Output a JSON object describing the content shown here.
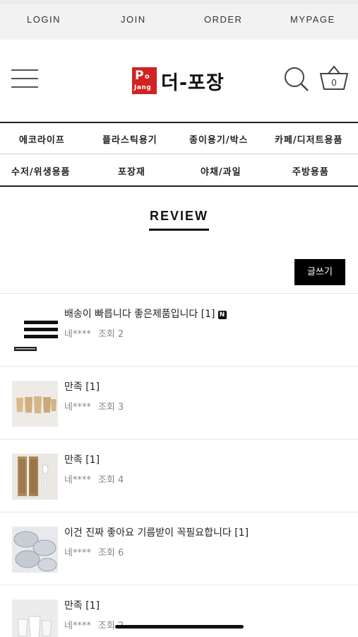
{
  "topnav": {
    "login": "LOGIN",
    "join": "JOIN",
    "order": "ORDER",
    "mypage": "MYPAGE"
  },
  "header": {
    "logo_mark_p": "P",
    "logo_mark_o": "o",
    "logo_mark_jang": "Jang",
    "logo_text": "더-포장",
    "cart_count": "0",
    "icons": {
      "menu": "hamburger-menu-icon",
      "search": "search-icon",
      "cart": "shopping-basket-icon"
    },
    "brand_color": "#d32222"
  },
  "categories": {
    "row1": [
      "에코라이프",
      "플라스틱용기",
      "종이용기/박스",
      "카페/디저트용품"
    ],
    "row2": [
      "수저/위생용품",
      "포장재",
      "야채/과일",
      "주방용품"
    ]
  },
  "review": {
    "title": "REVIEW",
    "write_button": "글쓰기"
  },
  "reviews": [
    {
      "title": "배송이 빠릅니다 좋은제품입니다 [1]",
      "badge": "N",
      "author": "네****",
      "views": "조회 2",
      "thumb": "striped-logo-product"
    },
    {
      "title": "만족 [1]",
      "author": "네****",
      "views": "조회 3",
      "thumb": "paper-cups"
    },
    {
      "title": "만족 [1]",
      "author": "네****",
      "views": "조회 4",
      "thumb": "wooden-chopsticks-spoon"
    },
    {
      "title": "이건 진짜 좋아요 기름받이 꼭필요합니다 [1]",
      "author": "네****",
      "views": "조회 6",
      "thumb": "mesh-oil-trays"
    },
    {
      "title": "만족 [1]",
      "author": "네****",
      "views": "조회 2",
      "thumb": "white-cups"
    }
  ]
}
